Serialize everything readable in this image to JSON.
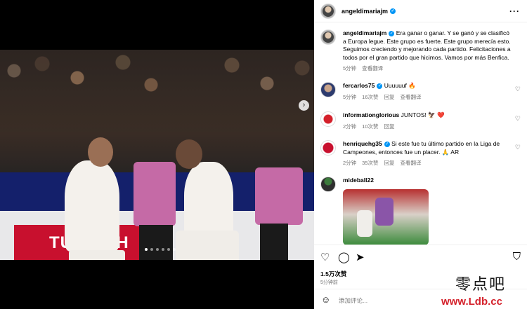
{
  "post": {
    "username": "angeldimariajm",
    "more_icon": "ellipsis-icon",
    "caption": {
      "username": "angeldimariajm",
      "text": "Era ganar o ganar. Y se ganó y se clasificó a Europa legue. Este grupo es fuerte. Este grupo merecía esto. Seguimos creciendo y mejorando cada partido. Felicitaciones a todos por el gran partido que hicimos. Vamos por más Benfica.",
      "time": "5分钟",
      "see_translation": "查看翻译"
    },
    "image": {
      "ad_text": "TURKISH",
      "carousel_dots": 6,
      "active_dot": 0
    }
  },
  "comments": [
    {
      "username": "fercarlos75",
      "verified": true,
      "text": "Uuuuuuf 🔥",
      "time": "5分钟",
      "likes": "16次赞",
      "reply": "回复",
      "translate": "查看翻译"
    },
    {
      "username": "informationglorious",
      "verified": false,
      "text": "JUNTOS! 🦅 ❤️",
      "time": "2分钟",
      "likes": "10次赞",
      "reply": "回复",
      "translate": ""
    },
    {
      "username": "henriquehg35",
      "verified": true,
      "text": "Si este fue tu último partido en la Liga de Campeones, entonces fue un placer. 🙏 AR",
      "time": "2分钟",
      "likes": "35次赞",
      "reply": "回复",
      "translate": "查看翻译"
    },
    {
      "username": "mideball22",
      "verified": false,
      "text": "",
      "time": "",
      "likes": "",
      "reply": "",
      "translate": ""
    }
  ],
  "actions": {
    "likes_count": "1.5万次赞",
    "post_time": "5分钟前",
    "add_comment_placeholder": "添加评论..."
  },
  "watermark": {
    "cn": "零点吧",
    "url": "www.Ldb.cc"
  }
}
